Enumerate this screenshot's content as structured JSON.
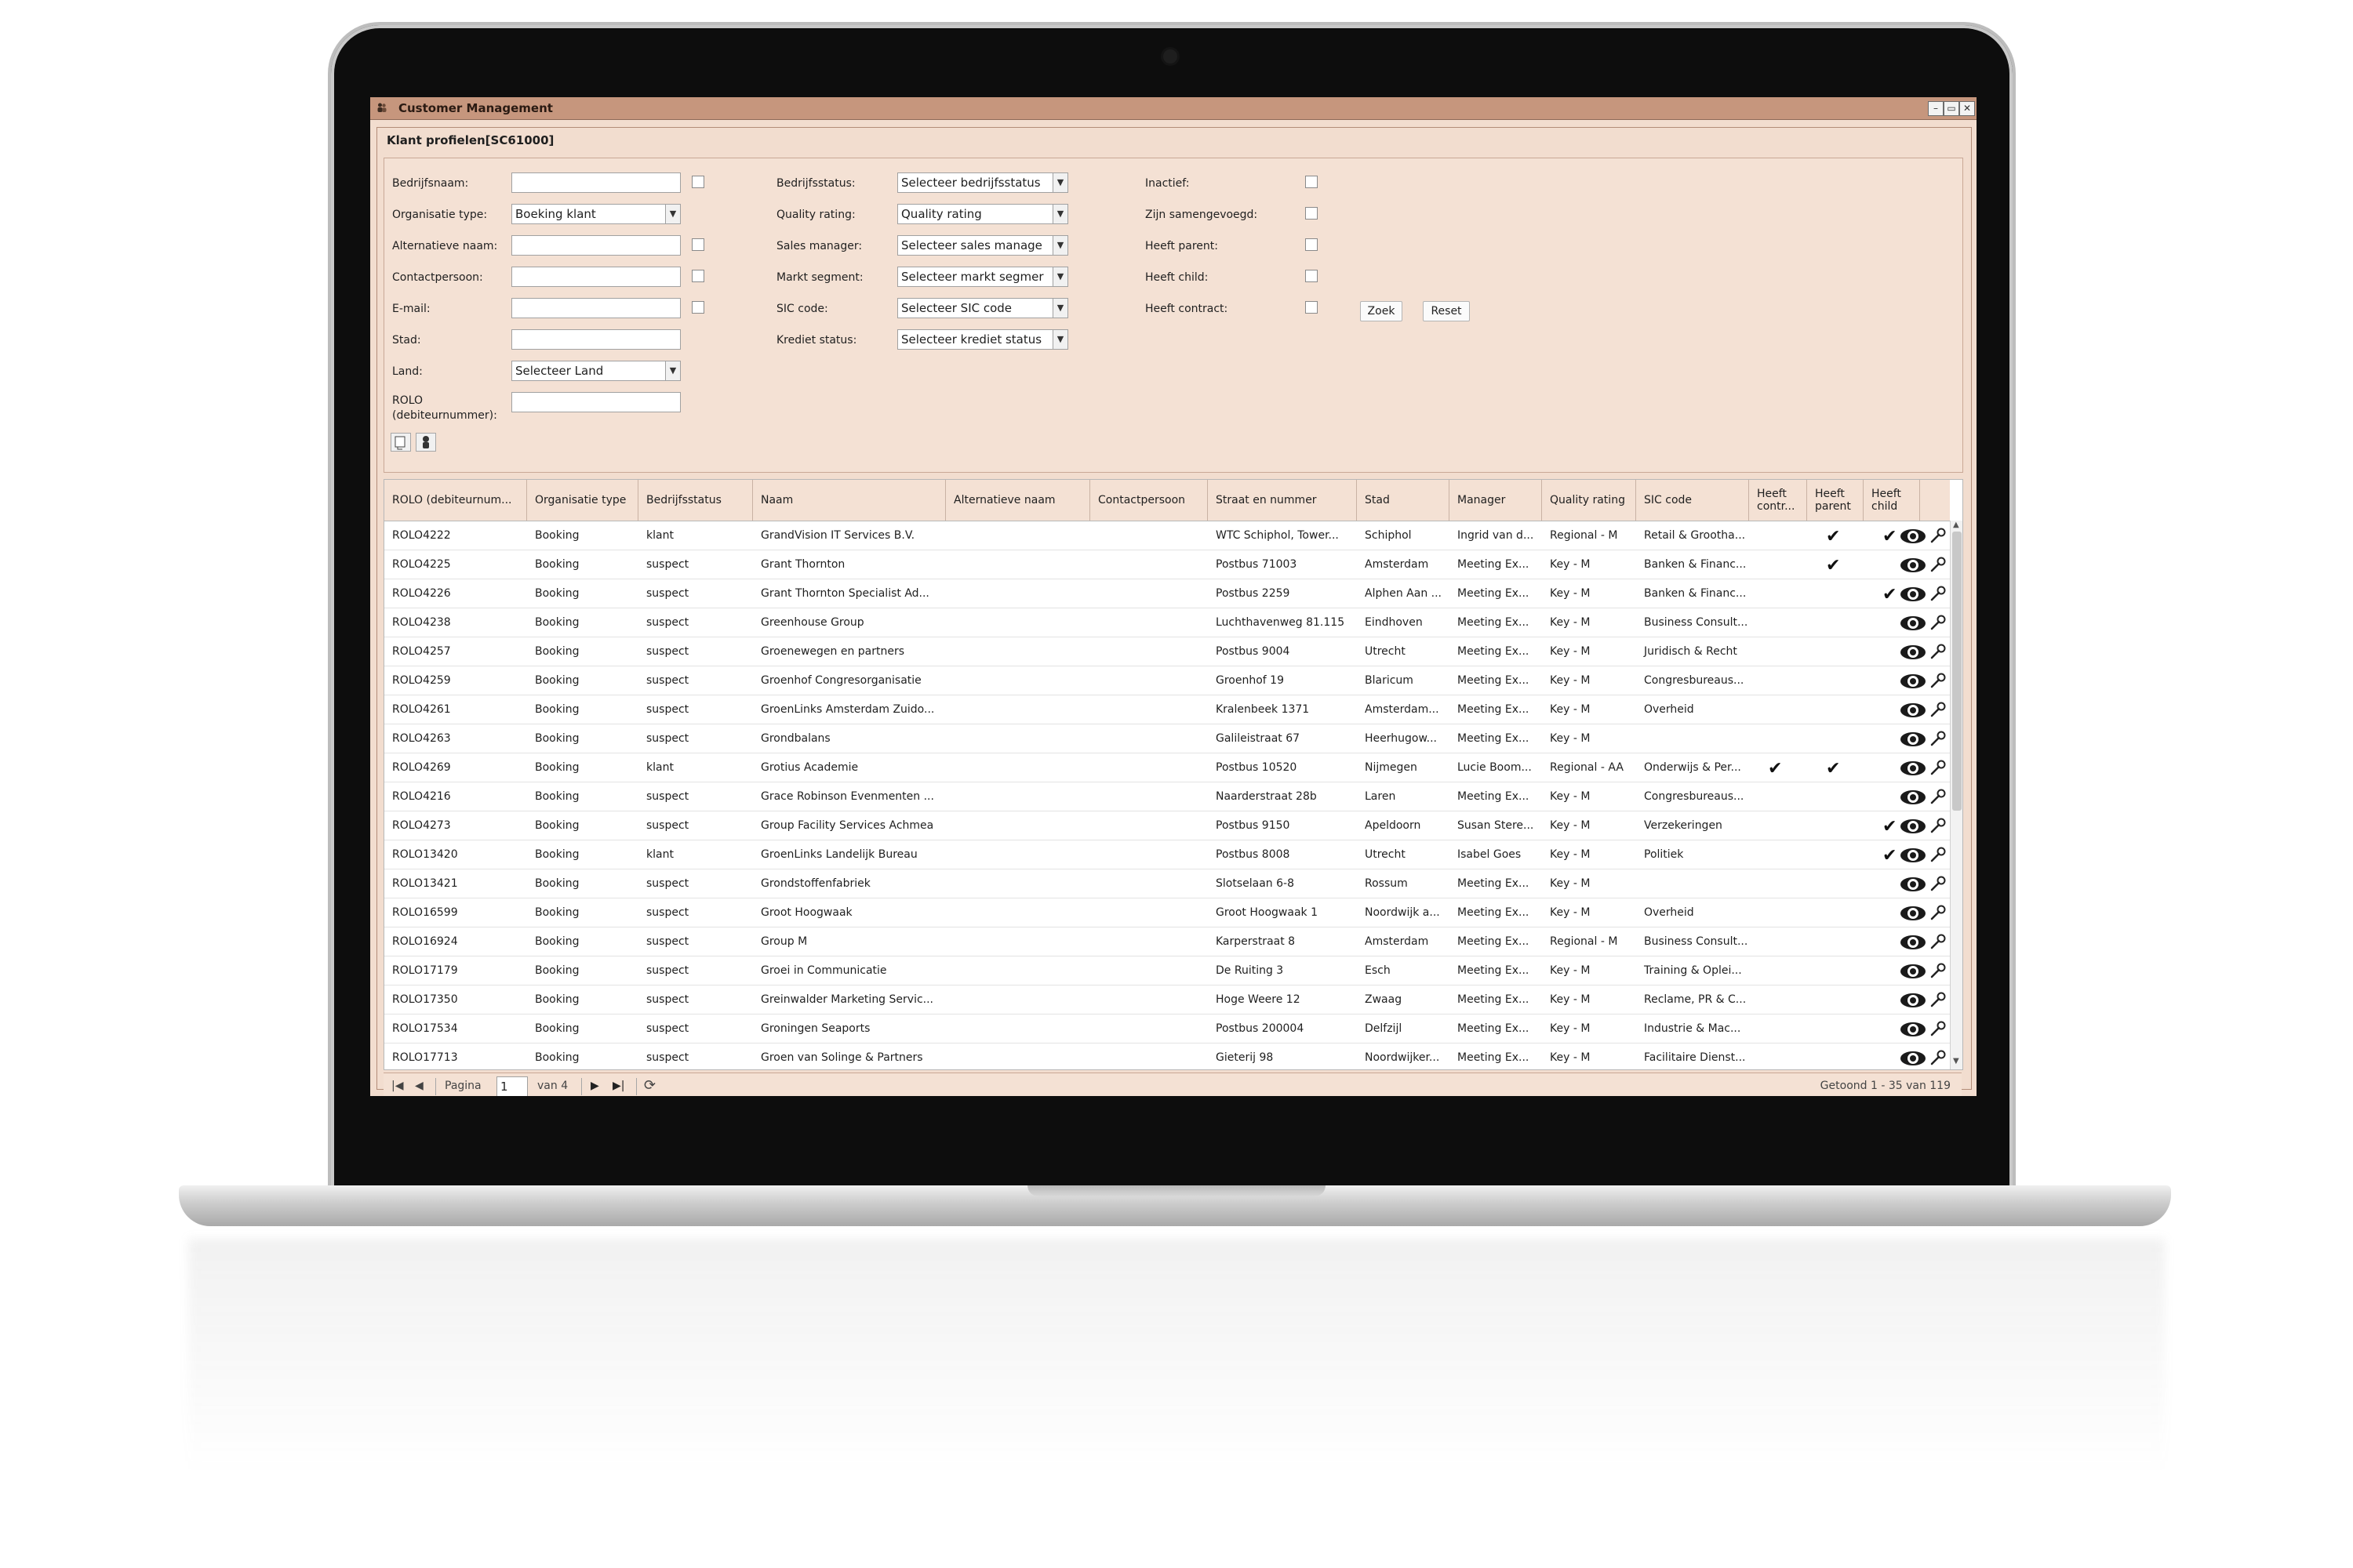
{
  "window": {
    "title": "Customer Management",
    "buttons": [
      "–",
      "▭",
      "✕"
    ]
  },
  "panel": {
    "title": "Klant profielen[SC61000]"
  },
  "filters": {
    "col1": [
      {
        "label": "Bedrijfsnaam:",
        "type": "text",
        "value": "",
        "checkbox": true
      },
      {
        "label": "Organisatie type:",
        "type": "select",
        "value": "Boeking klant",
        "checkbox": false
      },
      {
        "label": "Alternatieve naam:",
        "type": "text",
        "value": "",
        "checkbox": true
      },
      {
        "label": "Contactpersoon:",
        "type": "text",
        "value": "",
        "checkbox": true
      },
      {
        "label": "E-mail:",
        "type": "text",
        "value": "",
        "checkbox": true
      },
      {
        "label": "Stad:",
        "type": "text",
        "value": "",
        "checkbox": false
      },
      {
        "label": "Land:",
        "type": "select",
        "value": "Selecteer Land",
        "checkbox": false
      },
      {
        "label": "ROLO (debiteurnummer):",
        "type": "text",
        "value": "",
        "checkbox": false
      }
    ],
    "col2": [
      {
        "label": "Bedrijfsstatus:",
        "value": "Selecteer bedrijfsstatus"
      },
      {
        "label": "Quality rating:",
        "value": "Quality rating"
      },
      {
        "label": "Sales manager:",
        "value": "Selecteer sales manage"
      },
      {
        "label": "Markt segment:",
        "value": "Selecteer markt segmer"
      },
      {
        "label": "SIC code:",
        "value": "Selecteer SIC code"
      },
      {
        "label": "Krediet status:",
        "value": "Selecteer krediet status"
      }
    ],
    "col3": [
      {
        "label": "Inactief:"
      },
      {
        "label": "Zijn samengevoegd:"
      },
      {
        "label": "Heeft parent:"
      },
      {
        "label": "Heeft child:"
      },
      {
        "label": "Heeft contract:"
      }
    ],
    "search_button": "Zoek",
    "reset_button": "Reset"
  },
  "table": {
    "columns": [
      "ROLO (debiteurnum...",
      "Organisatie type",
      "Bedrijfsstatus",
      "Naam",
      "Alternatieve naam",
      "Contactpersoon",
      "Straat en nummer",
      "Stad",
      "Manager",
      "Quality rating",
      "SIC code",
      "Heeft contr...",
      "Heeft parent",
      "Heeft child"
    ],
    "rows": [
      {
        "rolo": "ROLO4222",
        "org": "Booking",
        "status": "klant",
        "naam": "GrandVision IT Services B.V.",
        "alt": "",
        "contact": "",
        "straat": "WTC Schiphol, Tower...",
        "stad": "Schiphol",
        "manager": "Ingrid van d...",
        "quality": "Regional - M",
        "sic": "Retail & Grootha...",
        "contract": false,
        "parent": true,
        "child": true
      },
      {
        "rolo": "ROLO4225",
        "org": "Booking",
        "status": "suspect",
        "naam": "Grant Thornton",
        "alt": "",
        "contact": "",
        "straat": "Postbus 71003",
        "stad": "Amsterdam",
        "manager": "Meeting Ex...",
        "quality": "Key - M",
        "sic": "Banken & Financ...",
        "contract": false,
        "parent": true,
        "child": false
      },
      {
        "rolo": "ROLO4226",
        "org": "Booking",
        "status": "suspect",
        "naam": "Grant Thornton Specialist Ad...",
        "alt": "",
        "contact": "",
        "straat": "Postbus 2259",
        "stad": "Alphen Aan ...",
        "manager": "Meeting Ex...",
        "quality": "Key - M",
        "sic": "Banken & Financ...",
        "contract": false,
        "parent": false,
        "child": true
      },
      {
        "rolo": "ROLO4238",
        "org": "Booking",
        "status": "suspect",
        "naam": "Greenhouse Group",
        "alt": "",
        "contact": "",
        "straat": "Luchthavenweg 81.115",
        "stad": "Eindhoven",
        "manager": "Meeting Ex...",
        "quality": "Key - M",
        "sic": "Business Consult...",
        "contract": false,
        "parent": false,
        "child": false
      },
      {
        "rolo": "ROLO4257",
        "org": "Booking",
        "status": "suspect",
        "naam": "Groenewegen en partners",
        "alt": "",
        "contact": "",
        "straat": "Postbus 9004",
        "stad": "Utrecht",
        "manager": "Meeting Ex...",
        "quality": "Key - M",
        "sic": "Juridisch & Recht",
        "contract": false,
        "parent": false,
        "child": false
      },
      {
        "rolo": "ROLO4259",
        "org": "Booking",
        "status": "suspect",
        "naam": "Groenhof Congresorganisatie",
        "alt": "",
        "contact": "",
        "straat": "Groenhof 19",
        "stad": "Blaricum",
        "manager": "Meeting Ex...",
        "quality": "Key - M",
        "sic": "Congresbureaus...",
        "contract": false,
        "parent": false,
        "child": false
      },
      {
        "rolo": "ROLO4261",
        "org": "Booking",
        "status": "suspect",
        "naam": "GroenLinks Amsterdam Zuido...",
        "alt": "",
        "contact": "",
        "straat": "Kralenbeek 1371",
        "stad": "Amsterdam...",
        "manager": "Meeting Ex...",
        "quality": "Key - M",
        "sic": "Overheid",
        "contract": false,
        "parent": false,
        "child": false
      },
      {
        "rolo": "ROLO4263",
        "org": "Booking",
        "status": "suspect",
        "naam": "Grondbalans",
        "alt": "",
        "contact": "",
        "straat": "Galileistraat 67",
        "stad": "Heerhugow...",
        "manager": "Meeting Ex...",
        "quality": "Key - M",
        "sic": "",
        "contract": false,
        "parent": false,
        "child": false
      },
      {
        "rolo": "ROLO4269",
        "org": "Booking",
        "status": "klant",
        "naam": "Grotius Academie",
        "alt": "",
        "contact": "",
        "straat": "Postbus 10520",
        "stad": "Nijmegen",
        "manager": "Lucie Boom...",
        "quality": "Regional - AA",
        "sic": "Onderwijs & Per...",
        "contract": true,
        "parent": true,
        "child": false
      },
      {
        "rolo": "ROLO4216",
        "org": "Booking",
        "status": "suspect",
        "naam": "Grace Robinson Evenmenten ...",
        "alt": "",
        "contact": "",
        "straat": "Naarderstraat 28b",
        "stad": "Laren",
        "manager": "Meeting Ex...",
        "quality": "Key - M",
        "sic": "Congresbureaus...",
        "contract": false,
        "parent": false,
        "child": false
      },
      {
        "rolo": "ROLO4273",
        "org": "Booking",
        "status": "suspect",
        "naam": "Group Facility Services Achmea",
        "alt": "",
        "contact": "",
        "straat": "Postbus 9150",
        "stad": "Apeldoorn",
        "manager": "Susan Stere...",
        "quality": "Key - M",
        "sic": "Verzekeringen",
        "contract": false,
        "parent": false,
        "child": true
      },
      {
        "rolo": "ROLO13420",
        "org": "Booking",
        "status": "klant",
        "naam": "GroenLinks Landelijk Bureau",
        "alt": "",
        "contact": "",
        "straat": "Postbus 8008",
        "stad": "Utrecht",
        "manager": "Isabel Goes",
        "quality": "Key - M",
        "sic": "Politiek",
        "contract": false,
        "parent": false,
        "child": true
      },
      {
        "rolo": "ROLO13421",
        "org": "Booking",
        "status": "suspect",
        "naam": "Grondstoffenfabriek",
        "alt": "",
        "contact": "",
        "straat": "Slotselaan 6-8",
        "stad": "Rossum",
        "manager": "Meeting Ex...",
        "quality": "Key - M",
        "sic": "",
        "contract": false,
        "parent": false,
        "child": false
      },
      {
        "rolo": "ROLO16599",
        "org": "Booking",
        "status": "suspect",
        "naam": "Groot Hoogwaak",
        "alt": "",
        "contact": "",
        "straat": "Groot Hoogwaak 1",
        "stad": "Noordwijk a...",
        "manager": "Meeting Ex...",
        "quality": "Key - M",
        "sic": "Overheid",
        "contract": false,
        "parent": false,
        "child": false
      },
      {
        "rolo": "ROLO16924",
        "org": "Booking",
        "status": "suspect",
        "naam": "Group M",
        "alt": "",
        "contact": "",
        "straat": "Karperstraat 8",
        "stad": "Amsterdam",
        "manager": "Meeting Ex...",
        "quality": "Regional - M",
        "sic": "Business Consult...",
        "contract": false,
        "parent": false,
        "child": false
      },
      {
        "rolo": "ROLO17179",
        "org": "Booking",
        "status": "suspect",
        "naam": "Groei in Communicatie",
        "alt": "",
        "contact": "",
        "straat": "De Ruiting 3",
        "stad": "Esch",
        "manager": "Meeting Ex...",
        "quality": "Key - M",
        "sic": "Training & Oplei...",
        "contract": false,
        "parent": false,
        "child": false
      },
      {
        "rolo": "ROLO17350",
        "org": "Booking",
        "status": "suspect",
        "naam": "Greinwalder Marketing Servic...",
        "alt": "",
        "contact": "",
        "straat": "Hoge Weere 12",
        "stad": "Zwaag",
        "manager": "Meeting Ex...",
        "quality": "Key - M",
        "sic": "Reclame, PR & C...",
        "contract": false,
        "parent": false,
        "child": false
      },
      {
        "rolo": "ROLO17534",
        "org": "Booking",
        "status": "suspect",
        "naam": "Groningen Seaports",
        "alt": "",
        "contact": "",
        "straat": "Postbus 200004",
        "stad": "Delfzijl",
        "manager": "Meeting Ex...",
        "quality": "Key - M",
        "sic": "Industrie & Mac...",
        "contract": false,
        "parent": false,
        "child": false
      },
      {
        "rolo": "ROLO17713",
        "org": "Booking",
        "status": "suspect",
        "naam": "Groen van Solinge & Partners",
        "alt": "",
        "contact": "",
        "straat": "Gieterij 98",
        "stad": "Noordwijker...",
        "manager": "Meeting Ex...",
        "quality": "Key - M",
        "sic": "Facilitaire Dienst...",
        "contract": false,
        "parent": false,
        "child": false
      }
    ]
  },
  "pager": {
    "page_label": "Pagina",
    "page_value": "1",
    "of_label": "van 4",
    "summary": "Getoond 1 - 35 van 119"
  },
  "colors": {
    "accent": "#c6967d",
    "panel_bg": "#f2ddcf"
  },
  "icons": {
    "window": "people-icon",
    "view": "eye-icon",
    "edit": "wrench-icon",
    "check": "check-icon"
  }
}
